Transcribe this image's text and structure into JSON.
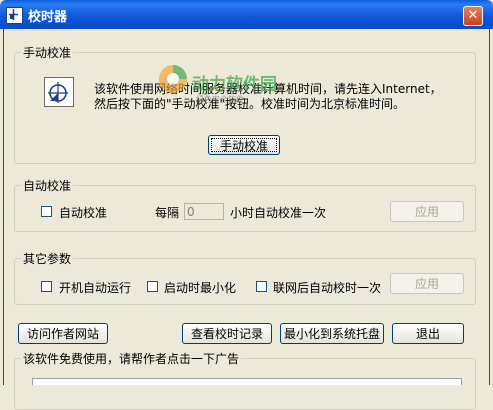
{
  "window": {
    "title": "校时器",
    "close_glyph": "✕",
    "app_icon": "clock-app-icon"
  },
  "manual": {
    "legend": "手动校准",
    "description_line1": "该软件使用网络时间服务器校准计算机时间，请先连入Internet，",
    "description_line2": "然后按下面的\"手动校准\"按钮。校准时间为北京标准时间。",
    "button": "手动校准",
    "icon": "clock-sync-icon",
    "watermark_text": "动力软件园",
    "watermark_sub": "绿色安全软件"
  },
  "auto": {
    "legend": "自动校准",
    "checkbox_label": "自动校准",
    "checked": false,
    "interval_prefix": "每隔",
    "interval_value": "0",
    "interval_suffix": "小时自动校准一次",
    "apply_button": "应用"
  },
  "other": {
    "legend": "其它参数",
    "options": [
      {
        "label": "开机自动运行",
        "checked": false
      },
      {
        "label": "启动时最小化",
        "checked": false
      },
      {
        "label": "联网后自动校时一次",
        "checked": false
      }
    ],
    "apply_button": "应用"
  },
  "bottom_buttons": {
    "visit": "访问作者网站",
    "records": "查看校时记录",
    "tray": "最小化到系统托盘",
    "exit": "退出"
  },
  "ad": {
    "legend": "该软件免费使用，请帮作者点击一下广告"
  },
  "colors": {
    "title_bar": "#0a5fe0",
    "dialog_face": "#ece9d8",
    "close": "#c8421e"
  }
}
